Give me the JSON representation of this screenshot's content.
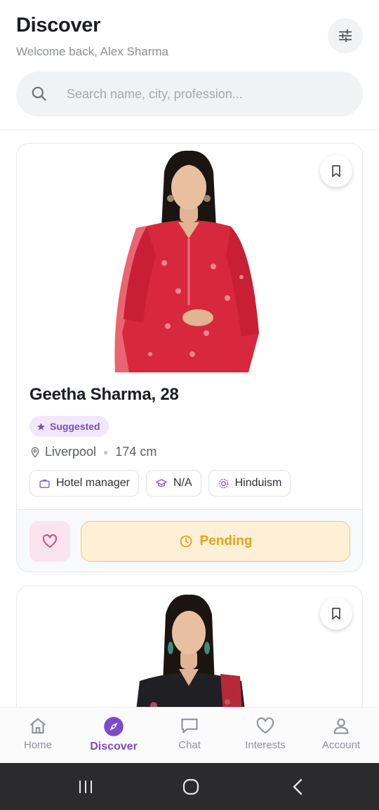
{
  "header": {
    "title": "Discover",
    "subtitle": "Welcome back, Alex Sharma",
    "filter_icon": "sliders-icon"
  },
  "search": {
    "placeholder": "Search name, city, profession...",
    "value": ""
  },
  "profiles": [
    {
      "name_age": "Geetha Sharma, 28",
      "badge": "Suggested",
      "location": "Liverpool",
      "height": "174 cm",
      "chips": [
        {
          "icon": "briefcase-icon",
          "label": "Hotel manager"
        },
        {
          "icon": "graduation-cap-icon",
          "label": "N/A"
        },
        {
          "icon": "religion-icon",
          "label": "Hinduism"
        }
      ],
      "status_label": "Pending",
      "outfit_color": "#d8283d"
    },
    {
      "outfit_color": "#1f1f24"
    }
  ],
  "bottom_nav": [
    {
      "label": "Home",
      "icon": "home-icon",
      "active": false
    },
    {
      "label": "Discover",
      "icon": "compass-icon",
      "active": true
    },
    {
      "label": "Chat",
      "icon": "chat-icon",
      "active": false
    },
    {
      "label": "Interests",
      "icon": "heart-icon",
      "active": false
    },
    {
      "label": "Account",
      "icon": "user-icon",
      "active": false
    }
  ],
  "colors": {
    "accent": "#7d4bc8",
    "pending_bg": "#fdf0d7",
    "pending_text": "#e6a21b",
    "like_bg": "#fbe4ee",
    "heart": "#d64a7f"
  }
}
